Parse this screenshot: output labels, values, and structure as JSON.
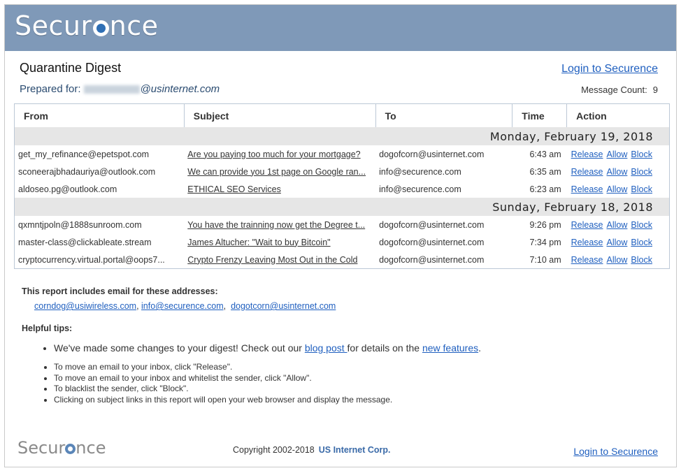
{
  "brand": {
    "name": "Securence"
  },
  "header": {
    "title": "Quarantine Digest",
    "prepared_label": "Prepared for:",
    "prepared_email_suffix": "@usinternet.com",
    "login_link": "Login to Securence",
    "message_count_label": "Message Count:",
    "message_count": "9"
  },
  "table": {
    "columns": [
      "From",
      "Subject",
      "To",
      "Time",
      "Action"
    ],
    "actions": [
      "Release",
      "Allow",
      "Block"
    ],
    "groups": [
      {
        "date": "Monday, February 19, 2018",
        "messages": [
          {
            "from": "get_my_refinance@epetspot.com",
            "subject": "Are you paying too much for your mortgage?",
            "to": "dogofcorn@usinternet.com",
            "time": "6:43 am"
          },
          {
            "from": "sconeerajbhadauriya@outlook.com",
            "subject": "We can provide you 1st page on Google ran...",
            "to": "info@securence.com",
            "time": "6:35 am"
          },
          {
            "from": "aldoseo.pg@outlook.com",
            "subject": "ETHICAL SEO Services",
            "to": "info@securence.com",
            "time": "6:23 am"
          }
        ]
      },
      {
        "date": "Sunday, February 18, 2018",
        "messages": [
          {
            "from": "qxmntjpoln@1888sunroom.com",
            "subject": "You have the trainning now get the Degree t...",
            "to": "dogofcorn@usinternet.com",
            "time": "9:26 pm"
          },
          {
            "from": "master-class@clickableate.stream",
            "subject": "James Altucher: \"Wait to buy Bitcoin\"",
            "to": "dogofcorn@usinternet.com",
            "time": "7:34 pm"
          },
          {
            "from": "cryptocurrency.virtual.portal@oops7...",
            "subject": "Crypto Frenzy Leaving Most Out in the Cold",
            "to": "dogofcorn@usinternet.com",
            "time": "7:10 am"
          }
        ]
      }
    ]
  },
  "addresses": {
    "heading": "This report includes email for these addresses:",
    "list": [
      "corndog@usiwireless.com",
      "info@securence.com",
      "dogotcorn@usinternet.com"
    ]
  },
  "tips": {
    "heading": "Helpful tips:",
    "main_pre": "We've made some changes to your digest! Check out our ",
    "main_link1": "blog post ",
    "main_mid": "for details on the ",
    "main_link2": "new features",
    "main_post": ".",
    "items": [
      "To move an email to your inbox, click \"Release\".",
      "To move an email to your inbox and whitelist the sender, click \"Allow\".",
      "To blacklist the sender, click \"Block\".",
      "Clicking on subject links in this report will open your web browser and display the message."
    ]
  },
  "footer": {
    "copyright": "Copyright 2002-2018",
    "company": "US Internet Corp.",
    "login_link": "Login to Securence"
  },
  "colors": {
    "banner": "#7f99b8",
    "link": "#1f5fbf",
    "date_row": "#e6e6e6"
  }
}
